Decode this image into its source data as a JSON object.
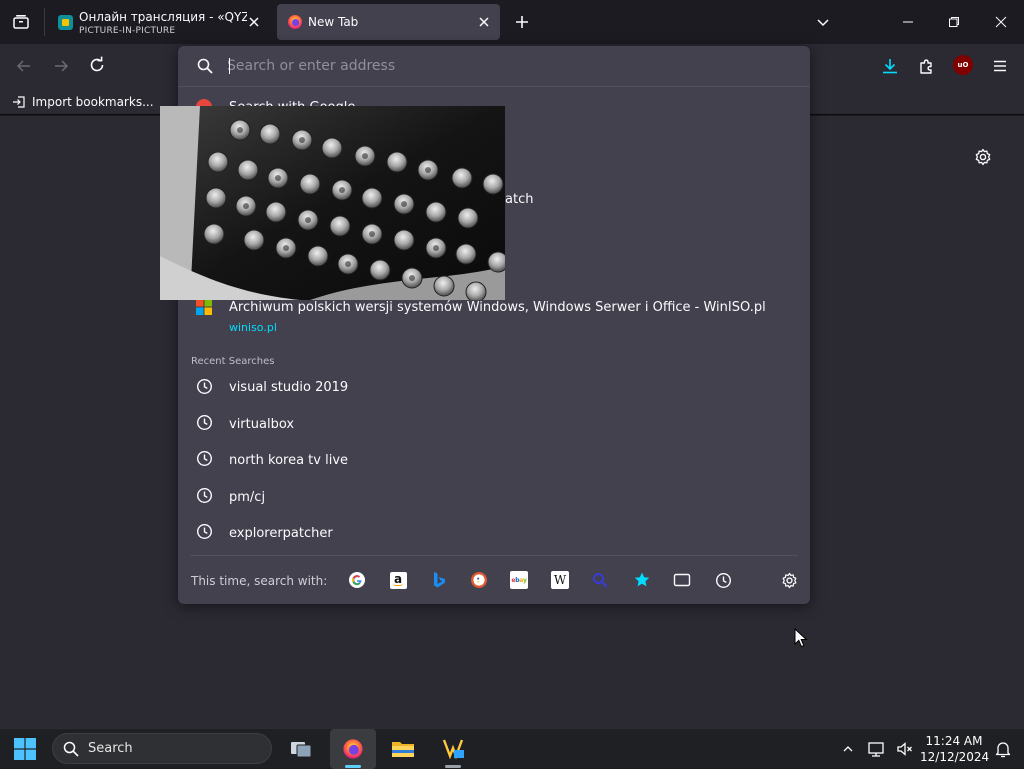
{
  "tabs": [
    {
      "title": "Онлайн трансляция - «QYZYL",
      "subtitle": "PICTURE-IN-PICTURE",
      "active": false
    },
    {
      "title": "New Tab",
      "active": true
    }
  ],
  "bookmarks": {
    "import_label": "Import bookmarks..."
  },
  "urlbar": {
    "placeholder": "Search or enter address",
    "value": ""
  },
  "results": {
    "first_row_fragment": "Search with Google",
    "partial_row_suffix": "atch",
    "winiso": {
      "title": "Archiwum polskich wersji systemów Windows, Windows Serwer i Office - WinISO.pl",
      "url": "winiso.pl"
    }
  },
  "recent_searches": {
    "heading": "Recent Searches",
    "items": [
      "visual studio 2019",
      "virtualbox",
      "north korea tv live",
      "pm/cj",
      "explorerpatcher"
    ]
  },
  "search_with": {
    "label": "This time, search with:",
    "engines": [
      "google-icon",
      "amazon-icon",
      "bing-icon",
      "duckduckgo-icon",
      "ebay-icon",
      "wikipedia-icon",
      "search-mode-icon",
      "bookmarks-star-icon",
      "tabs-icon",
      "history-icon"
    ]
  },
  "extension_badge": "uO",
  "taskbar": {
    "search_label": "Search",
    "time": "11:24 AM",
    "date": "12/12/2024"
  },
  "colors": {
    "accent": "#00ddff",
    "popup_bg": "#42414d",
    "toolbar_bg": "#2b2a33",
    "frame_bg": "#1c1b22"
  }
}
